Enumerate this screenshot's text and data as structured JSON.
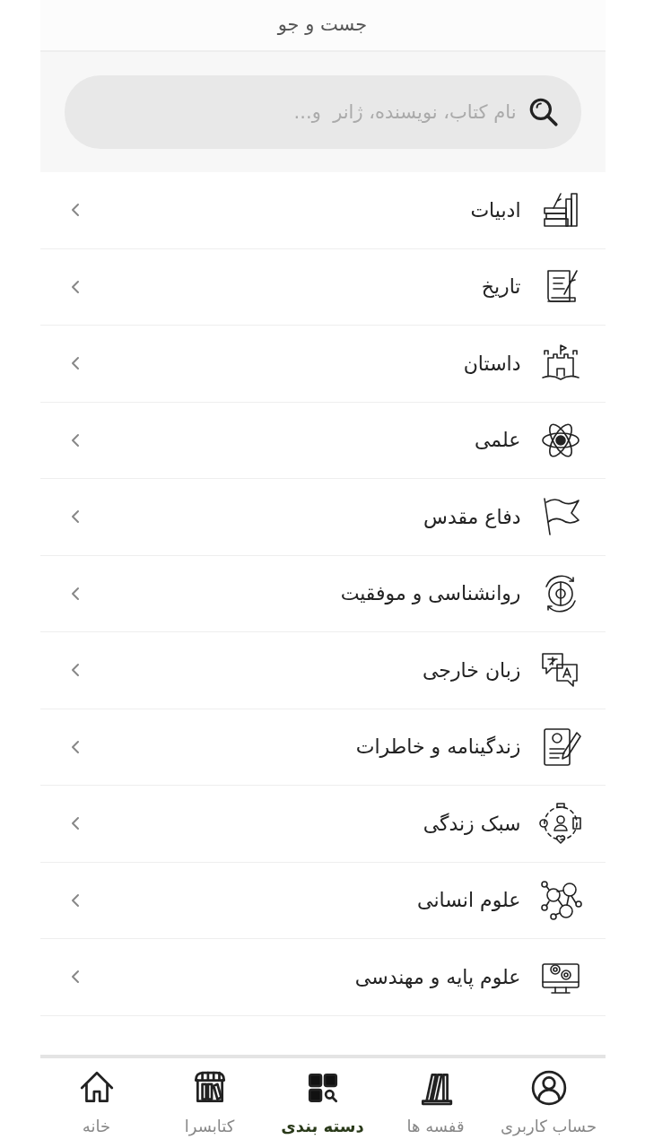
{
  "header": {
    "title": "جست و جو"
  },
  "search": {
    "placeholder": "نام کتاب، نویسنده، ژانر  و..."
  },
  "categories": [
    {
      "label": "ادبیات"
    },
    {
      "label": "تاریخ"
    },
    {
      "label": "داستان"
    },
    {
      "label": "علمی"
    },
    {
      "label": "دفاع مقدس"
    },
    {
      "label": "روانشناسی و موفقیت"
    },
    {
      "label": "زبان خارجی"
    },
    {
      "label": "زندگینامه و خاطرات"
    },
    {
      "label": "سبک زندگی"
    },
    {
      "label": "علوم انسانی"
    },
    {
      "label": "علوم پایه و مهندسی"
    }
  ],
  "bottom_nav": [
    {
      "label": "حساب کاربری",
      "selected": false
    },
    {
      "label": "قفسه ها",
      "selected": false
    },
    {
      "label": "دسته بندی",
      "selected": true
    },
    {
      "label": "کتابسرا",
      "selected": false
    },
    {
      "label": "خانه",
      "selected": false
    }
  ]
}
